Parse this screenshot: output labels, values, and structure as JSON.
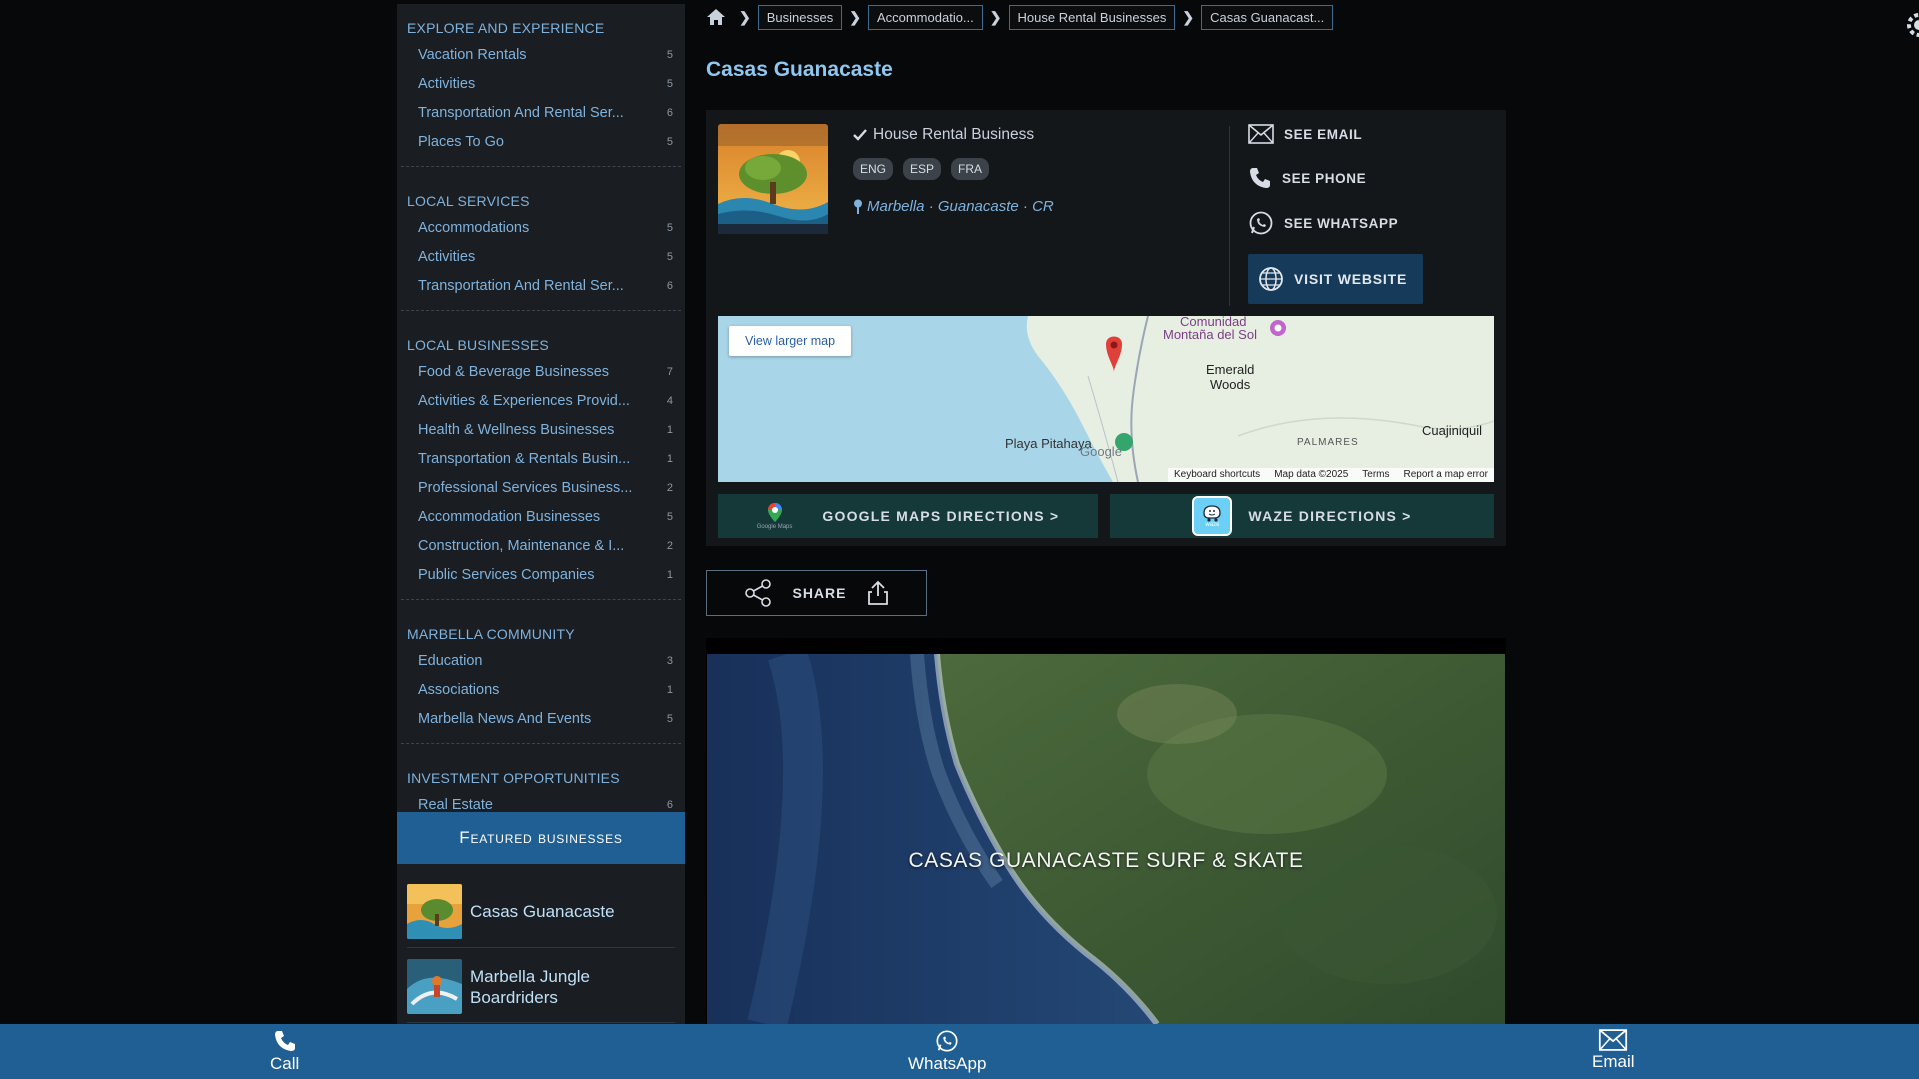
{
  "sidebar": {
    "sections": [
      {
        "title": "EXPLORE AND EXPERIENCE",
        "items": [
          {
            "label": "Vacation Rentals",
            "count": "5"
          },
          {
            "label": "Activities",
            "count": "5"
          },
          {
            "label": "Transportation And Rental Ser...",
            "count": "6"
          },
          {
            "label": "Places To Go",
            "count": "5"
          }
        ]
      },
      {
        "title": "LOCAL SERVICES",
        "items": [
          {
            "label": "Accommodations",
            "count": "5"
          },
          {
            "label": "Activities",
            "count": "5"
          },
          {
            "label": "Transportation And Rental Ser...",
            "count": "6"
          }
        ]
      },
      {
        "title": "LOCAL BUSINESSES",
        "items": [
          {
            "label": "Food & Beverage Businesses",
            "count": "7"
          },
          {
            "label": "Activities & Experiences Provid...",
            "count": "4"
          },
          {
            "label": "Health & Wellness Businesses",
            "count": "1"
          },
          {
            "label": "Transportation & Rentals Busin...",
            "count": "1"
          },
          {
            "label": "Professional Services Business...",
            "count": "2"
          },
          {
            "label": "Accommodation Businesses",
            "count": "5"
          },
          {
            "label": "Construction, Maintenance & I...",
            "count": "2"
          },
          {
            "label": "Public Services Companies",
            "count": "1"
          }
        ]
      },
      {
        "title": "MARBELLA COMMUNITY",
        "items": [
          {
            "label": "Education",
            "count": "3"
          },
          {
            "label": "Associations",
            "count": "1"
          },
          {
            "label": "Marbella News And Events",
            "count": "5"
          }
        ]
      },
      {
        "title": "INVESTMENT OPPORTUNITIES",
        "items": [
          {
            "label": "Real Estate",
            "count": "6"
          }
        ]
      }
    ],
    "featured_title": "Featured businesses",
    "featured": [
      {
        "name": "Casas Guanacaste"
      },
      {
        "name": "Marbella Jungle Boardriders"
      }
    ]
  },
  "breadcrumb": [
    "Businesses",
    "Accommodatio...",
    "House Rental Businesses",
    "Casas Guanacast..."
  ],
  "page_title": "Casas Guanacaste",
  "business": {
    "type": "House Rental Business",
    "languages": [
      "ENG",
      "ESP",
      "FRA"
    ],
    "location": "Marbella · Guanacaste · CR",
    "see_email": "SEE EMAIL",
    "see_phone": "SEE PHONE",
    "see_whatsapp": "SEE WHATSAPP",
    "visit_website": "VISIT WEBSITE"
  },
  "map": {
    "view_larger": "View larger map",
    "labels": {
      "comunidad": "Comunidad",
      "montana": "Montaña del Sol",
      "emerald1": "Emerald",
      "emerald2": "Woods",
      "playa": "Playa Pitahaya",
      "palmares": "PALMARES",
      "cuajiniquil": "Cuajiniquil",
      "google": "Google"
    },
    "footer": [
      "Keyboard shortcuts",
      "Map data ©2025",
      "Terms",
      "Report a map error"
    ]
  },
  "directions": {
    "google": "GOOGLE MAPS DIRECTIONS >",
    "waze": "WAZE DIRECTIONS >",
    "google_maps_caption": "Google Maps",
    "waze_caption": "waze"
  },
  "share_label": "SHARE",
  "video_title": "CASAS GUANACASTE SURF & SKATE",
  "bottom_bar": {
    "call": "Call",
    "whatsapp": "WhatsApp",
    "email": "Email"
  },
  "colors": {
    "accent_blue": "#1f5f93",
    "link_blue": "#7fb2dd",
    "title_blue": "#8ec7ef",
    "dir_button": "#153838",
    "visit_button": "#163a5a"
  }
}
